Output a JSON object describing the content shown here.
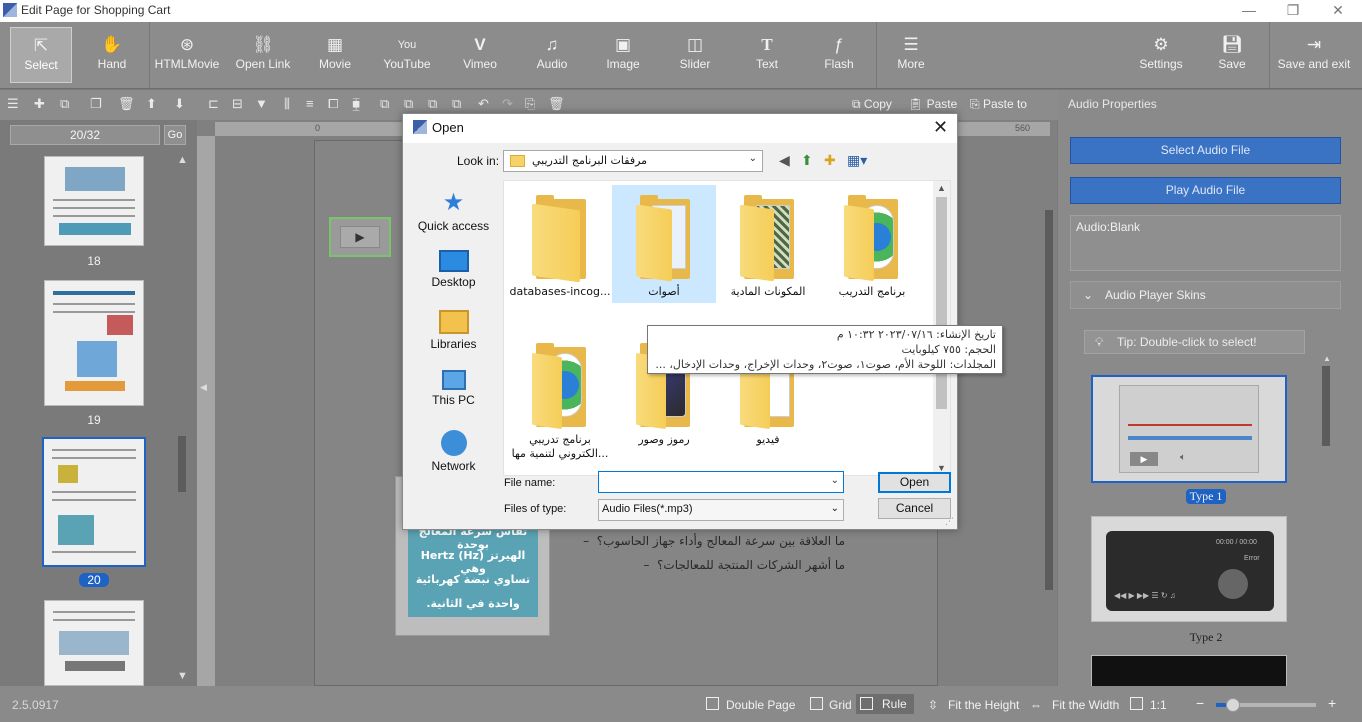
{
  "window": {
    "title": "Edit Page for Shopping Cart"
  },
  "ribbon": {
    "select": "Select",
    "hand": "Hand",
    "htmlmovie": "HTMLMovie",
    "openlink": "Open Link",
    "movie": "Movie",
    "youtube": "YouTube",
    "vimeo": "Vimeo",
    "audio": "Audio",
    "image": "Image",
    "slider": "Slider",
    "text": "Text",
    "flash": "Flash",
    "more": "More",
    "settings": "Settings",
    "save": "Save",
    "save_exit": "Save and exit"
  },
  "toolbar2": {
    "copy": "Copy",
    "paste": "Paste",
    "paste_to": "Paste to"
  },
  "pages": {
    "current": "20/32",
    "go": "Go",
    "thumbs": [
      {
        "num": "18"
      },
      {
        "num": "19"
      },
      {
        "num": "20"
      }
    ]
  },
  "canvas": {
    "ruler_h_labels": [
      "0",
      "560"
    ],
    "question_lines": [
      "ما العلاقة بين سرعة المعالج وأداء جهاز الحاسوب؟",
      "ما أشهر الشركات المنتجة للمعالجات؟"
    ],
    "bullet": "–",
    "card_lines": [
      "تقاس سرعة المعالج بوحدة",
      "الهيرتز (Hz) Hertz وهي",
      "تساوي نبضة كهربائية",
      "واحدة في الثانية."
    ]
  },
  "right_panel": {
    "title": "Audio Properties",
    "select_audio": "Select Audio File",
    "play_audio": "Play Audio File",
    "audio_value": "Audio:Blank",
    "skins_header": "Audio Player Skins",
    "tip": "Tip: Double-click to select!",
    "skin1": "Type 1",
    "skin2": "Type 2",
    "skin2_time": "00:00 / 00:00",
    "skin2_status": "Error"
  },
  "statusbar": {
    "version": "2.5.0917",
    "double_page": "Double Page",
    "grid": "Grid",
    "rule": "Rule",
    "fit_height": "Fit the Height",
    "fit_width": "Fit the Width",
    "ratio": "1:1",
    "zoom_level": 0.1
  },
  "dialog": {
    "title": "Open",
    "look_in_label": "Look in:",
    "look_in_value": "مرفقات البرنامج التدريبي",
    "places": [
      "Quick access",
      "Desktop",
      "Libraries",
      "This PC",
      "Network"
    ],
    "files": [
      {
        "name": "databases-incog...",
        "selected": false
      },
      {
        "name": "أصوات",
        "selected": true
      },
      {
        "name": "المكونات المادية",
        "selected": false
      },
      {
        "name": "برنامج التدريب",
        "selected": false
      },
      {
        "name": "برنامج تدريبي الكتروني لتنمية مها...",
        "selected": false
      },
      {
        "name": "رموز وصور",
        "selected": false
      },
      {
        "name": "فيديو",
        "selected": false
      }
    ],
    "tooltip": [
      "تاريخ الإنشاء: ٢٠٢٣/٠٧/١٦ ١٠:٣٢ م",
      "الحجم: ٧٥٥ كيلوبايت",
      "المجلدات: اللوحة الأم، صوت١، صوت٢، وحدات الإخراج، وحدات الإدخال، ..."
    ],
    "file_name_label": "File name:",
    "file_name_value": "",
    "file_type_label": "Files of type:",
    "file_type_value": "Audio Files(*.mp3)",
    "open_button": "Open",
    "cancel_button": "Cancel"
  }
}
